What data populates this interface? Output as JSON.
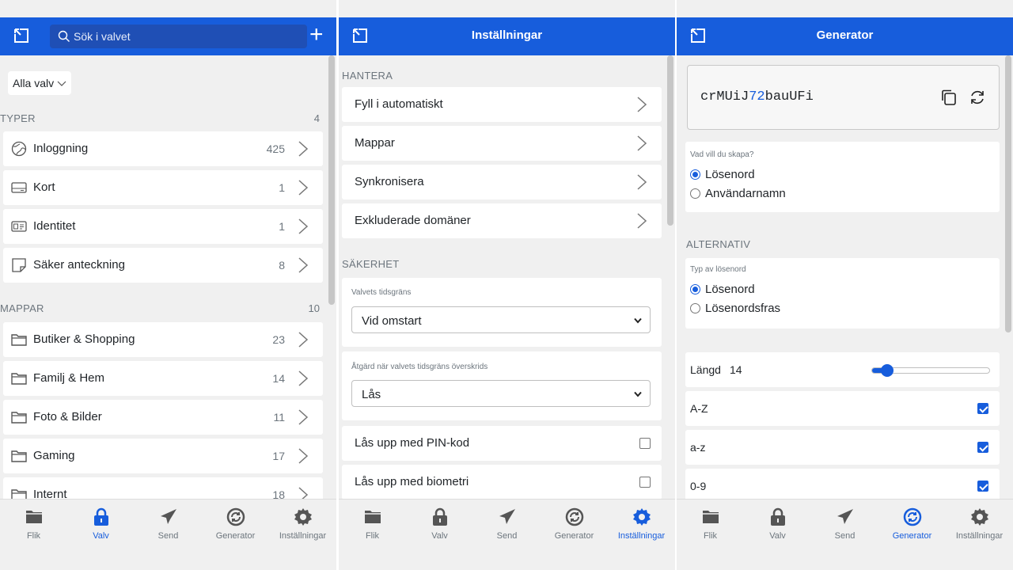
{
  "vault": {
    "search_placeholder": "Sök i valvet",
    "vault_selector": "Alla valv",
    "types": {
      "label": "TYPER",
      "count": "4",
      "items": [
        {
          "label": "Inloggning",
          "count": "425",
          "icon": "globe-icon"
        },
        {
          "label": "Kort",
          "count": "1",
          "icon": "card-icon"
        },
        {
          "label": "Identitet",
          "count": "1",
          "icon": "id-card-icon"
        },
        {
          "label": "Säker anteckning",
          "count": "8",
          "icon": "note-icon"
        }
      ]
    },
    "folders": {
      "label": "MAPPAR",
      "count": "10",
      "items": [
        {
          "label": "Butiker & Shopping",
          "count": "23"
        },
        {
          "label": "Familj & Hem",
          "count": "14"
        },
        {
          "label": "Foto & Bilder",
          "count": "11"
        },
        {
          "label": "Gaming",
          "count": "17"
        },
        {
          "label": "Internt",
          "count": "18"
        }
      ]
    }
  },
  "settings": {
    "title": "Inställningar",
    "manage": {
      "label": "HANTERA",
      "items": [
        "Fyll i automatiskt",
        "Mappar",
        "Synkronisera",
        "Exkluderade domäner"
      ]
    },
    "security": {
      "label": "SÄKERHET",
      "vault_timeout_label": "Valvets tidsgräns",
      "vault_timeout_value": "Vid omstart",
      "timeout_action_label": "Åtgärd när valvets tidsgräns överskrids",
      "timeout_action_value": "Lås",
      "pin_label": "Lås upp med PIN-kod",
      "biometric_label": "Lås upp med biometri"
    }
  },
  "generator": {
    "title": "Generator",
    "password_prefix": "crMUiJ",
    "password_digits": "72",
    "password_suffix": "bauUFi",
    "what_label": "Vad vill du skapa?",
    "what_options": [
      "Lösenord",
      "Användarnamn"
    ],
    "what_selected": "Lösenord",
    "options_label": "ALTERNATIV",
    "type_label": "Typ av lösenord",
    "type_options": [
      "Lösenord",
      "Lösenordsfras"
    ],
    "type_selected": "Lösenord",
    "length_label": "Längd",
    "length_value": "14",
    "length_fraction": 0.1,
    "toggles": [
      {
        "label": "A-Z",
        "checked": true
      },
      {
        "label": "a-z",
        "checked": true
      },
      {
        "label": "0-9",
        "checked": true
      }
    ]
  },
  "tabs": {
    "labels": [
      "Flik",
      "Valv",
      "Send",
      "Generator",
      "Inställningar"
    ],
    "icons": [
      "folder-icon",
      "lock-icon",
      "paper-plane-icon",
      "generator-icon",
      "gear-icon"
    ]
  },
  "colors": {
    "brand": "#175ddc",
    "background": "#f0f0f0",
    "muted": "#6c757d"
  }
}
